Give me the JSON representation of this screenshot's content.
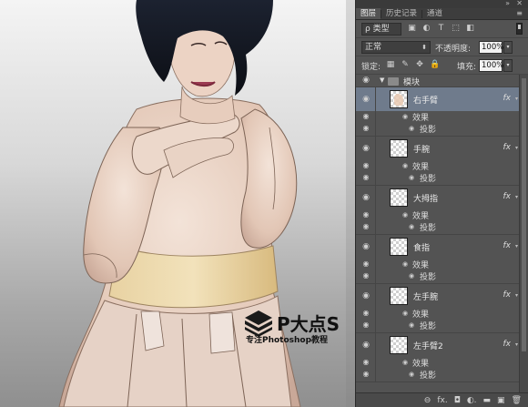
{
  "panel_tabs": [
    "图层",
    "历史记录",
    "通道"
  ],
  "filter": {
    "label": "ρ 类型",
    "icons": [
      "image-filter-icon",
      "adjustment-filter-icon",
      "type-filter-icon",
      "shape-filter-icon",
      "smart-object-filter-icon"
    ]
  },
  "blend": {
    "mode": "正常",
    "opacity_label": "不透明度:",
    "opacity_value": "100%"
  },
  "lock": {
    "label": "锁定:",
    "fill_label": "填充:",
    "fill_value": "100%"
  },
  "group": {
    "name": "模块"
  },
  "layers": [
    {
      "name": "右手臂",
      "fx": "fx",
      "effects_label": "效果",
      "effect": "投影",
      "selected": true
    },
    {
      "name": "手腕",
      "fx": "fx",
      "effects_label": "效果",
      "effect": "投影",
      "selected": false
    },
    {
      "name": "大拇指",
      "fx": "fx",
      "effects_label": "效果",
      "effect": "投影",
      "selected": false
    },
    {
      "name": "食指",
      "fx": "fx",
      "effects_label": "效果",
      "effect": "投影",
      "selected": false
    },
    {
      "name": "左手腕",
      "fx": "fx",
      "effects_label": "效果",
      "effect": "投影",
      "selected": false
    },
    {
      "name": "左手臂2",
      "fx": "fx",
      "effects_label": "效果",
      "effect": "投影",
      "selected": false
    }
  ],
  "bottom_icons": [
    "link-icon",
    "fx-icon",
    "mask-icon",
    "adjustment-icon",
    "folder-icon",
    "new-layer-icon",
    "trash-icon"
  ],
  "bottom_glyphs": [
    "⊖",
    "fx.",
    "◘",
    "◐.",
    "▬",
    "▣",
    "🗑"
  ],
  "watermark": {
    "title": "P大点S",
    "subtitle": "专注Photoshop教程"
  },
  "colors": {
    "panel_bg": "#535353",
    "selected_row": "#6f7b8c",
    "skin": "#e8cdb9",
    "gold_panel": "#e9d3a0"
  }
}
